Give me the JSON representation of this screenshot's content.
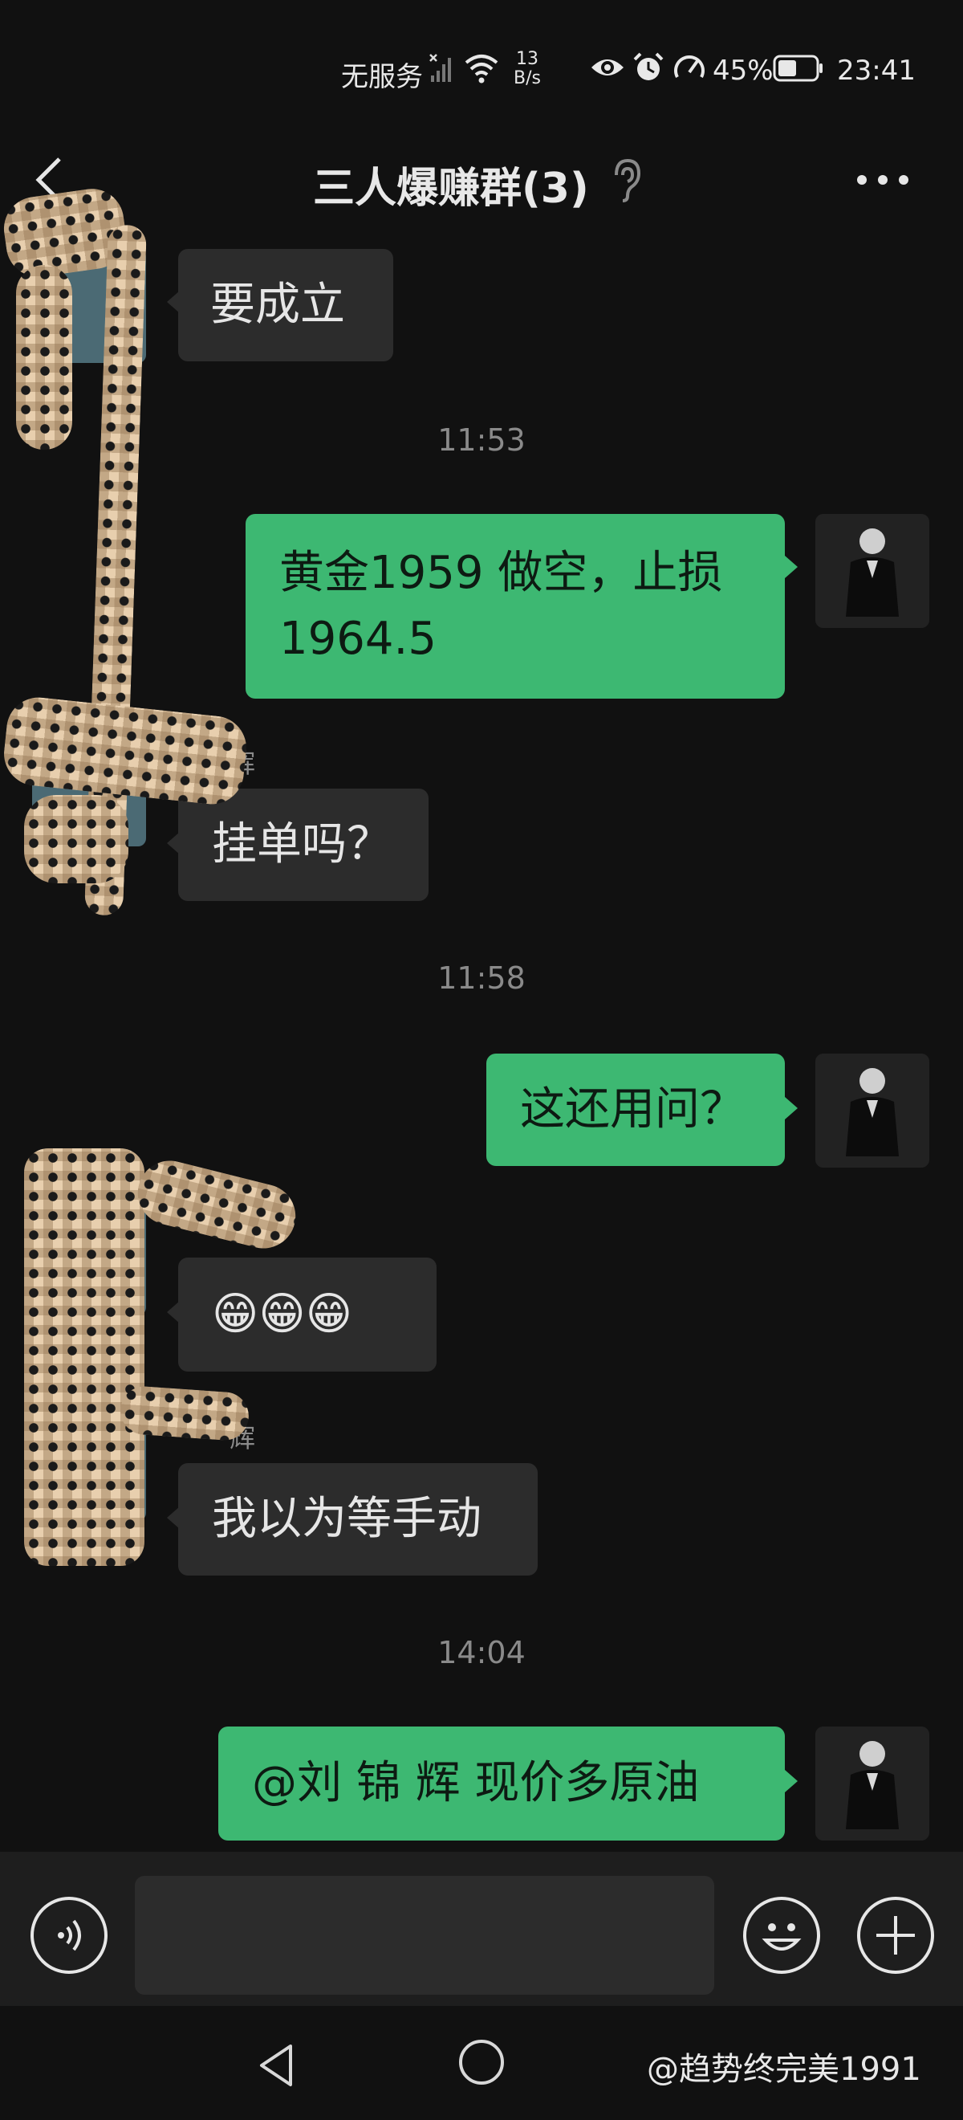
{
  "status_bar": {
    "carrier": "无服务",
    "speed_value": "13",
    "speed_unit": "B/s",
    "battery": "45%",
    "time": "23:41"
  },
  "header": {
    "title": "三人爆赚群(3)"
  },
  "messages": [
    {
      "side": "in",
      "text": "要成立"
    },
    {
      "type": "timestamp",
      "text": "11:53"
    },
    {
      "side": "out",
      "line1": "黄金1959 做空，止损",
      "line2": "1964.5"
    },
    {
      "side": "in",
      "sender": "辉",
      "text": "挂单吗？"
    },
    {
      "type": "timestamp",
      "text": "11:58"
    },
    {
      "side": "out",
      "text": "这还用问？"
    },
    {
      "side": "in",
      "text": "😁😁😁"
    },
    {
      "side": "in",
      "sender": "辉",
      "text": "我以为等手动"
    },
    {
      "type": "timestamp",
      "text": "14:04"
    },
    {
      "side": "out",
      "text": "@刘 锦 辉  现价多原油"
    }
  ],
  "watermark": "@趋势终完美1991",
  "colors": {
    "background": "#111111",
    "incoming_bubble": "#2c2c2c",
    "outgoing_bubble": "#3db872"
  },
  "icons": [
    "back-arrow-icon",
    "ear-icon",
    "more-dots-icon",
    "voice-icon",
    "emoji-icon",
    "plus-icon",
    "nav-back-icon",
    "nav-home-icon"
  ]
}
